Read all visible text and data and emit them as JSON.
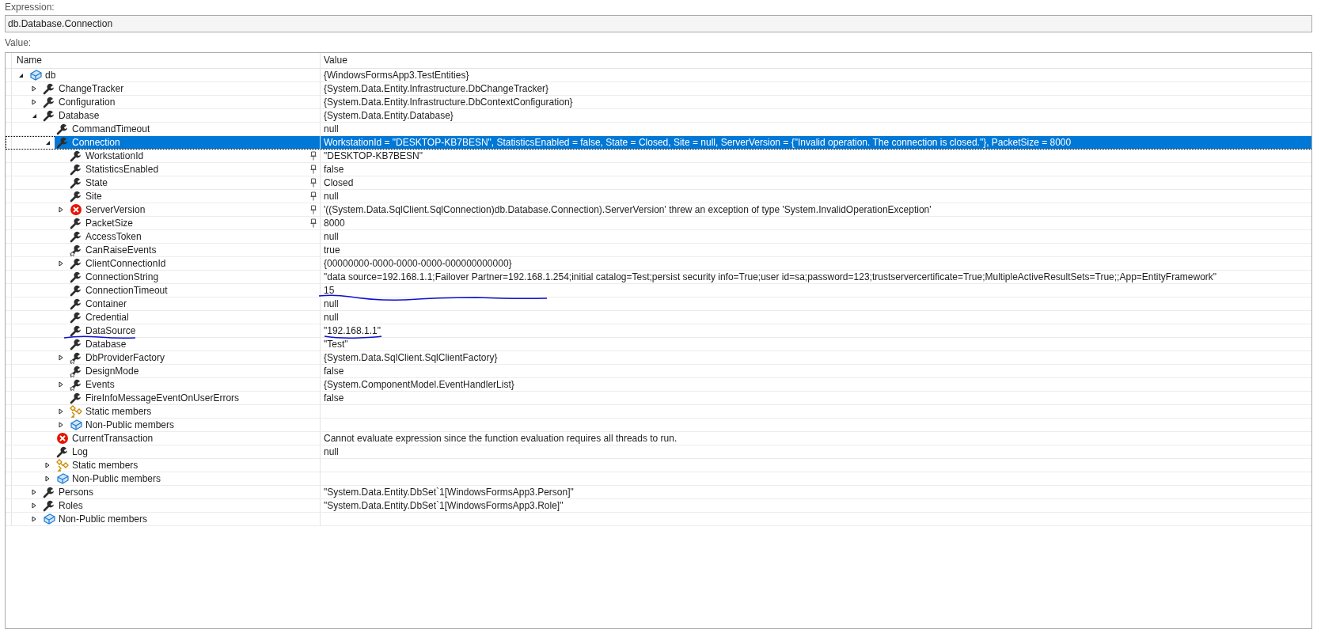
{
  "expression": {
    "label": "Expression:",
    "value": "db.Database.Connection"
  },
  "value_label": "Value:",
  "columns": [
    "Name",
    "Value"
  ],
  "rows": [
    {
      "name": "db",
      "value": "{WindowsFormsApp3.TestEntities}",
      "kind": "object",
      "expanded": true,
      "selected": false,
      "children": [
        {
          "name": "ChangeTracker",
          "value": "{System.Data.Entity.Infrastructure.DbChangeTracker}",
          "kind": "property",
          "expanded": false,
          "selected": false
        },
        {
          "name": "Configuration",
          "value": "{System.Data.Entity.Infrastructure.DbContextConfiguration}",
          "kind": "property",
          "expanded": false,
          "selected": false
        },
        {
          "name": "Database",
          "value": "{System.Data.Entity.Database}",
          "kind": "property",
          "expanded": true,
          "selected": false,
          "children": [
            {
              "name": "CommandTimeout",
              "value": "null",
              "kind": "property",
              "selected": false
            },
            {
              "name": "Connection",
              "value": "WorkstationId = \"DESKTOP-KB7BESN\", StatisticsEnabled = false, State = Closed, Site = null, ServerVersion = {\"Invalid operation. The connection is closed.\"}, PacketSize = 8000",
              "kind": "property",
              "expanded": true,
              "selected": true,
              "children": [
                {
                  "name": "WorkstationId",
                  "value": "\"DESKTOP-KB7BESN\"",
                  "kind": "property",
                  "pinned": true,
                  "selected": false
                },
                {
                  "name": "StatisticsEnabled",
                  "value": "false",
                  "kind": "property",
                  "pinned": true,
                  "selected": false
                },
                {
                  "name": "State",
                  "value": "Closed",
                  "kind": "property",
                  "pinned": true,
                  "selected": false
                },
                {
                  "name": "Site",
                  "value": "null",
                  "kind": "property",
                  "pinned": true,
                  "selected": false
                },
                {
                  "name": "ServerVersion",
                  "value": "'((System.Data.SqlClient.SqlConnection)db.Database.Connection).ServerVersion' threw an exception of type 'System.InvalidOperationException'",
                  "kind": "error",
                  "expanded": false,
                  "pinned": true,
                  "selected": false
                },
                {
                  "name": "PacketSize",
                  "value": "8000",
                  "kind": "property",
                  "pinned": true,
                  "selected": false
                },
                {
                  "name": "AccessToken",
                  "value": "null",
                  "kind": "property",
                  "selected": false
                },
                {
                  "name": "CanRaiseEvents",
                  "value": "true",
                  "kind": "inherited",
                  "selected": false
                },
                {
                  "name": "ClientConnectionId",
                  "value": "{00000000-0000-0000-0000-000000000000}",
                  "kind": "property",
                  "expanded": false,
                  "selected": false
                },
                {
                  "name": "ConnectionString",
                  "value": "\"data source=192.168.1.1;Failover Partner=192.168.1.254;initial catalog=Test;persist security info=True;user id=sa;password=123;trustservercertificate=True;MultipleActiveResultSets=True;;App=EntityFramework\"",
                  "kind": "property",
                  "selected": false
                },
                {
                  "name": "ConnectionTimeout",
                  "value": "15",
                  "kind": "property",
                  "selected": false,
                  "value_marked": true
                },
                {
                  "name": "Container",
                  "value": "null",
                  "kind": "property",
                  "selected": false
                },
                {
                  "name": "Credential",
                  "value": "null",
                  "kind": "property",
                  "selected": false
                },
                {
                  "name": "DataSource",
                  "value": "\"192.168.1.1\"",
                  "kind": "property",
                  "selected": false,
                  "name_marked": true,
                  "value_marked": true
                },
                {
                  "name": "Database",
                  "value": "\"Test\"",
                  "kind": "property",
                  "selected": false
                },
                {
                  "name": "DbProviderFactory",
                  "value": "{System.Data.SqlClient.SqlClientFactory}",
                  "kind": "inherited",
                  "expanded": false,
                  "selected": false
                },
                {
                  "name": "DesignMode",
                  "value": "false",
                  "kind": "inherited",
                  "selected": false
                },
                {
                  "name": "Events",
                  "value": "{System.ComponentModel.EventHandlerList}",
                  "kind": "inherited",
                  "expanded": false,
                  "selected": false
                },
                {
                  "name": "FireInfoMessageEventOnUserErrors",
                  "value": "false",
                  "kind": "property",
                  "selected": false
                },
                {
                  "name": "Static members",
                  "kind": "static",
                  "expanded": false,
                  "selected": false
                },
                {
                  "name": "Non-Public members",
                  "kind": "object",
                  "expanded": false,
                  "selected": false
                }
              ]
            },
            {
              "name": "CurrentTransaction",
              "value": "Cannot evaluate expression since the function evaluation requires all threads to run.",
              "kind": "error",
              "selected": false
            },
            {
              "name": "Log",
              "value": "null",
              "kind": "property",
              "selected": false
            },
            {
              "name": "Static members",
              "kind": "static",
              "expanded": false,
              "selected": false
            },
            {
              "name": "Non-Public members",
              "kind": "object",
              "expanded": false,
              "selected": false
            }
          ]
        },
        {
          "name": "Persons",
          "value": "\"System.Data.Entity.DbSet`1[WindowsFormsApp3.Person]\"",
          "kind": "property",
          "expanded": false,
          "selected": false
        },
        {
          "name": "Roles",
          "value": "\"System.Data.Entity.DbSet`1[WindowsFormsApp3.Role]\"",
          "kind": "property",
          "expanded": false,
          "selected": false
        },
        {
          "name": "Non-Public members",
          "kind": "object",
          "expanded": false,
          "selected": false
        }
      ]
    }
  ]
}
